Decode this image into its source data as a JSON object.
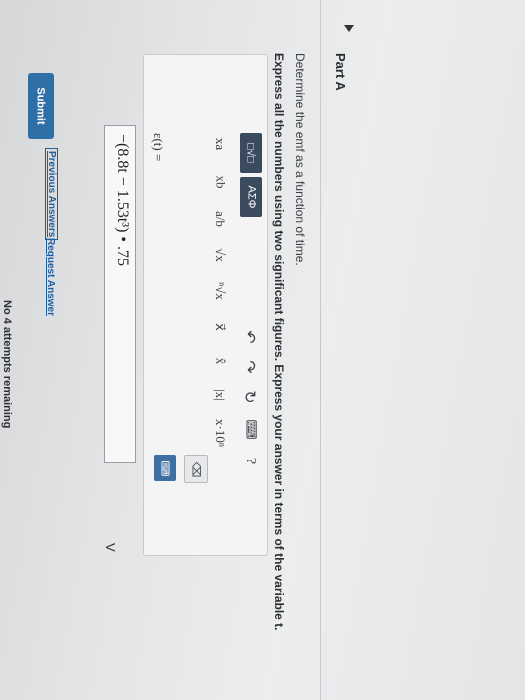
{
  "part": {
    "title": "Part A"
  },
  "question": {
    "line1": "Determine the emf as a function of time.",
    "line2": "Express all the numbers using two significant figures. Express your answer in terms of the variable t."
  },
  "toolbar": {
    "templates_label": "□√□",
    "greek_label": "AΣΦ",
    "row1": [
      "xa",
      "xb",
      "a/b",
      "√x",
      "ⁿ√x",
      "x⃗",
      "x̂",
      "|x|",
      "x·10ⁿ"
    ],
    "undo": "↶",
    "redo": "↷",
    "reset": "↻",
    "keyboard": "⌨",
    "help": "?",
    "delete": "⌫",
    "keypad": "⌨"
  },
  "answer": {
    "label": "ε(t) =",
    "expression": "−(8.8t − 1.53t³) • .75",
    "unit_dropdown": "V"
  },
  "actions": {
    "submit": "Submit",
    "previous": "Previous Answers",
    "request": "Request Answer",
    "attempts": "No 4 attempts remaining"
  }
}
